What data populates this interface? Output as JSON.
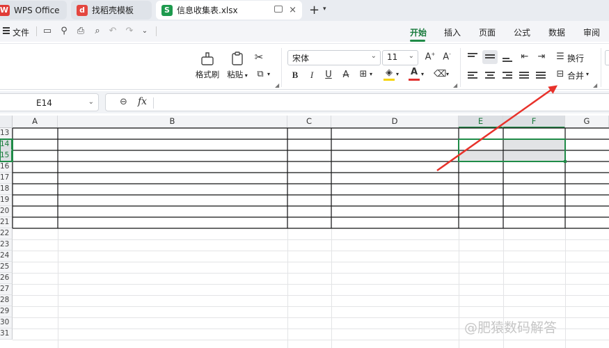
{
  "tabs": {
    "wps": "WPS Office",
    "template": "找稻壳模板",
    "doc": "信息收集表.xlsx",
    "new": "+",
    "close": "×"
  },
  "menu": {
    "file": "文件",
    "tabs": [
      "开始",
      "插入",
      "页面",
      "公式",
      "数据",
      "审阅"
    ],
    "active": "开始"
  },
  "ribbon": {
    "format_painter": "格式刷",
    "paste": "粘贴",
    "font_name": "宋体",
    "font_size": "11",
    "bold": "B",
    "italic": "I",
    "underline": "U",
    "strike": "A",
    "font_color_glyph": "A",
    "highlight_color": "#f5d300",
    "font_color": "#e0302f",
    "wrap": "换行",
    "merge": "合并"
  },
  "formula_bar": {
    "cell_ref": "E14",
    "fx": "fx",
    "content": ""
  },
  "grid": {
    "columns": [
      "A",
      "B",
      "C",
      "D",
      "E",
      "F",
      "G"
    ],
    "rows": [
      "13",
      "14",
      "15",
      "16",
      "17",
      "18",
      "19",
      "20",
      "21",
      "22",
      "23",
      "24",
      "25",
      "26",
      "27",
      "28",
      "29",
      "30",
      "31"
    ],
    "selected_columns": [
      "E",
      "F"
    ],
    "selected_rows": [
      "14",
      "15"
    ],
    "selection_color": "#1f8b47"
  },
  "annotation": {
    "arrow_color": "#e8322b"
  },
  "watermark": "@肥猿数码解答"
}
